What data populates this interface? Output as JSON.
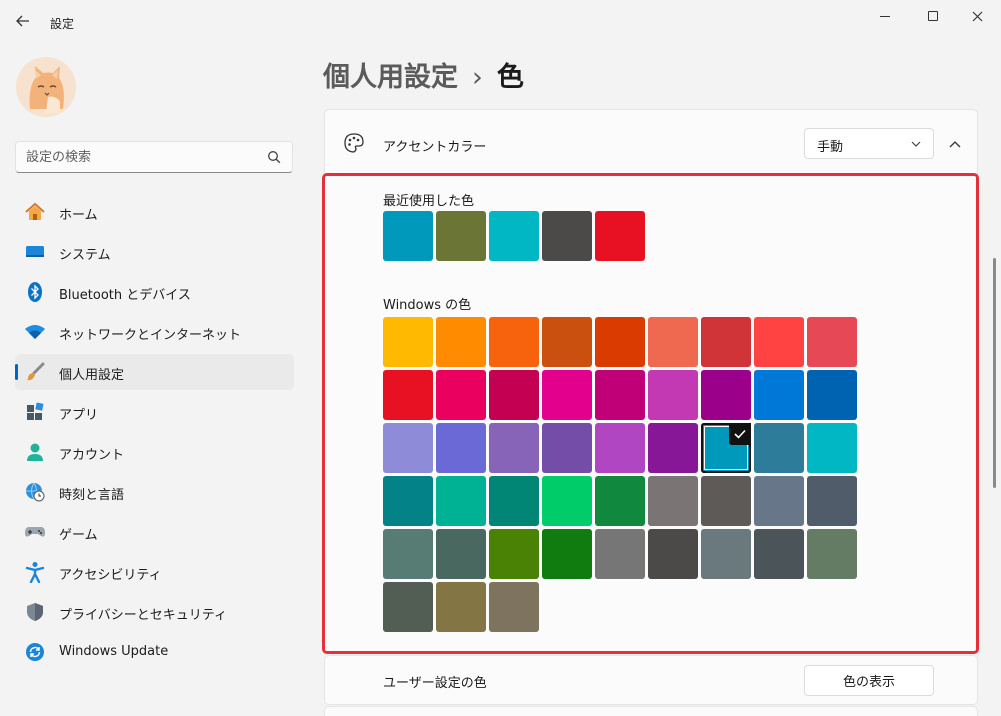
{
  "window": {
    "title": "設定",
    "back_icon": "back-arrow-icon",
    "controls": [
      "minimize-icon",
      "maximize-icon",
      "close-icon"
    ]
  },
  "search": {
    "placeholder": "設定の検索",
    "value": ""
  },
  "sidebar": {
    "items": [
      {
        "label": "ホーム",
        "icon": "home-icon"
      },
      {
        "label": "システム",
        "icon": "display-icon"
      },
      {
        "label": "Bluetooth とデバイス",
        "icon": "bluetooth-icon"
      },
      {
        "label": "ネットワークとインターネット",
        "icon": "wifi-icon"
      },
      {
        "label": "個人用設定",
        "icon": "brush-icon",
        "selected": true
      },
      {
        "label": "アプリ",
        "icon": "apps-icon"
      },
      {
        "label": "アカウント",
        "icon": "person-icon"
      },
      {
        "label": "時刻と言語",
        "icon": "globe-clock-icon"
      },
      {
        "label": "ゲーム",
        "icon": "gamepad-icon"
      },
      {
        "label": "アクセシビリティ",
        "icon": "accessibility-icon"
      },
      {
        "label": "プライバシーとセキュリティ",
        "icon": "shield-icon"
      },
      {
        "label": "Windows Update",
        "icon": "update-icon"
      }
    ]
  },
  "page": {
    "breadcrumb_parent": "個人用設定",
    "breadcrumb_separator": "›",
    "title": "色"
  },
  "accent": {
    "label": "アクセントカラー",
    "mode": "手動",
    "recent_label": "最近使用した色",
    "recent_colors": [
      "#0099bc",
      "#6b7536",
      "#00b7c3",
      "#4c4a48",
      "#e81123"
    ],
    "windows_label": "Windows の色",
    "windows_colors": [
      "#ffb900",
      "#ff8c00",
      "#f7630c",
      "#ca5010",
      "#da3b01",
      "#ef6950",
      "#d13438",
      "#ff4343",
      "#e74856",
      "#e81123",
      "#ea005e",
      "#c30052",
      "#e3008c",
      "#bf0077",
      "#c239b3",
      "#9a0089",
      "#0078d7",
      "#0063b1",
      "#8e8cd8",
      "#6b69d6",
      "#8764b8",
      "#744da9",
      "#b146c2",
      "#881798",
      "#0099bc",
      "#2d7d9a",
      "#00b7c3",
      "#038387",
      "#00b294",
      "#018574",
      "#00cc6a",
      "#10893e",
      "#7a7574",
      "#5d5a58",
      "#68768a",
      "#515c6b",
      "#567c73",
      "#486860",
      "#498205",
      "#107c10",
      "#767676",
      "#4c4a48",
      "#69797e",
      "#4a5459",
      "#647c64",
      "#525e54",
      "#847545",
      "#7e735f"
    ],
    "selected_index": 24
  },
  "custom": {
    "label": "ユーザー設定の色",
    "button_label": "色の表示"
  }
}
